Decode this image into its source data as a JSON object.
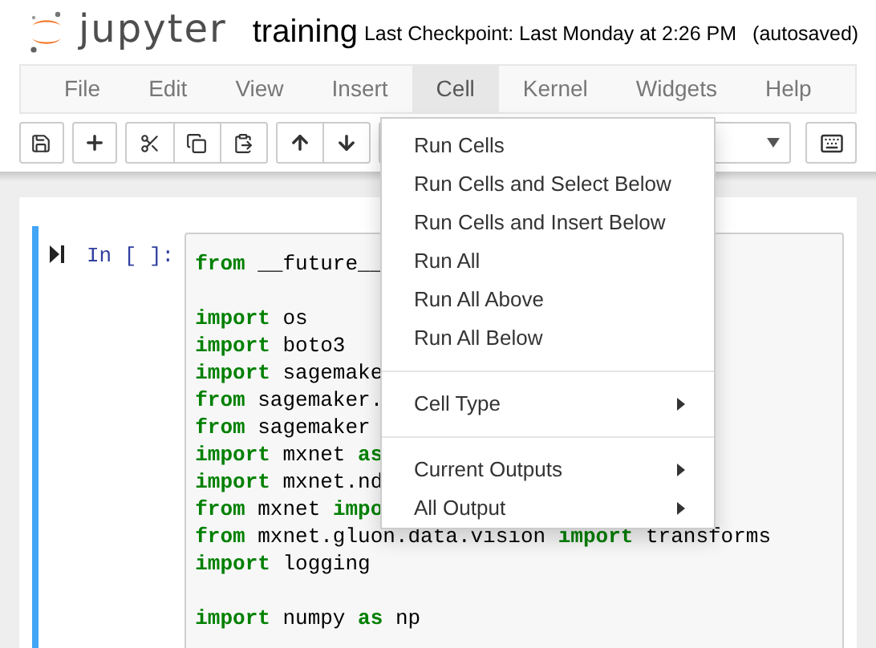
{
  "header": {
    "logo_text": "jupyter",
    "notebook_name": "training",
    "checkpoint": "Last Checkpoint: Last Monday at 2:26 PM",
    "autosave": "(autosaved)"
  },
  "menubar": [
    {
      "label": "File",
      "selected": false
    },
    {
      "label": "Edit",
      "selected": false
    },
    {
      "label": "View",
      "selected": false
    },
    {
      "label": "Insert",
      "selected": false
    },
    {
      "label": "Cell",
      "selected": true
    },
    {
      "label": "Kernel",
      "selected": false
    },
    {
      "label": "Widgets",
      "selected": false
    },
    {
      "label": "Help",
      "selected": false
    }
  ],
  "cell_menu": [
    {
      "kind": "item",
      "label": "Run Cells"
    },
    {
      "kind": "item",
      "label": "Run Cells and Select Below"
    },
    {
      "kind": "item",
      "label": "Run Cells and Insert Below"
    },
    {
      "kind": "item",
      "label": "Run All"
    },
    {
      "kind": "item",
      "label": "Run All Above"
    },
    {
      "kind": "item",
      "label": "Run All Below"
    },
    {
      "kind": "divider"
    },
    {
      "kind": "submenu",
      "label": "Cell Type"
    },
    {
      "kind": "divider"
    },
    {
      "kind": "submenu",
      "label": "Current Outputs"
    },
    {
      "kind": "submenu",
      "label": "All Output"
    }
  ],
  "cell": {
    "prompt": "In [ ]:",
    "code_lines": [
      [
        {
          "kind": "keyword",
          "text": "from"
        },
        {
          "kind": "plain",
          "text": " __future__"
        },
        {
          "kind": "break"
        }
      ],
      [
        {
          "kind": "keyword",
          "text": "import"
        },
        {
          "kind": "plain",
          "text": " os"
        }
      ],
      [
        {
          "kind": "keyword",
          "text": "import"
        },
        {
          "kind": "plain",
          "text": " boto3"
        }
      ],
      [
        {
          "kind": "keyword",
          "text": "import"
        },
        {
          "kind": "plain",
          "text": " sagemake"
        }
      ],
      [
        {
          "kind": "keyword",
          "text": "from"
        },
        {
          "kind": "plain",
          "text": " sagemaker."
        }
      ],
      [
        {
          "kind": "keyword",
          "text": "from"
        },
        {
          "kind": "plain",
          "text": " sagemaker"
        }
      ],
      [
        {
          "kind": "keyword",
          "text": "import"
        },
        {
          "kind": "plain",
          "text": " mxnet "
        },
        {
          "kind": "keyword",
          "text": "as"
        }
      ],
      [
        {
          "kind": "keyword",
          "text": "import"
        },
        {
          "kind": "plain",
          "text": " mxnet.nd"
        }
      ],
      [
        {
          "kind": "keyword",
          "text": "from"
        },
        {
          "kind": "plain",
          "text": " mxnet "
        },
        {
          "kind": "keyword",
          "text": "impo"
        }
      ],
      [
        {
          "kind": "keyword",
          "text": "from"
        },
        {
          "kind": "plain",
          "text": " mxnet.gluon.data.vision "
        },
        {
          "kind": "keyword",
          "text": "import"
        },
        {
          "kind": "plain",
          "text": " transforms"
        }
      ],
      [
        {
          "kind": "keyword",
          "text": "import"
        },
        {
          "kind": "plain",
          "text": " logging"
        },
        {
          "kind": "break"
        }
      ],
      [
        {
          "kind": "keyword",
          "text": "import"
        },
        {
          "kind": "plain",
          "text": " numpy "
        },
        {
          "kind": "keyword",
          "text": "as"
        },
        {
          "kind": "plain",
          "text": " np"
        }
      ]
    ]
  }
}
